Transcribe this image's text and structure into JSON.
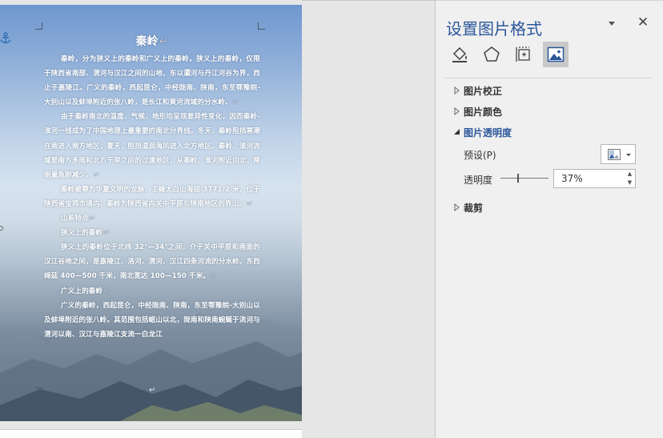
{
  "document": {
    "title": "秦岭",
    "paragraphs": [
      "秦岭，分为狭义上的秦岭和广义上的秦岭。狭义上的秦岭，仅限于陕西省南部、渭河与汉江之间的山地，东以灞河与丹江河谷为界，西止于嘉陵江。广义的秦岭，西起昆仑，中经陇南、陕南，东至鄂豫皖-大别山以及蚌埠附近的张八岭，是长江和黄河流域的分水岭。",
      "由于秦岭南北的温度、气候、地形均呈现差异性变化，因而秦岭-淮河一线成为了中国地理上最重要的南北分界线。冬天，秦岭阻挡寒潮在南进入南方地区；夏天，阻挡湿润海风进入北方地区。秦岭、淮河流域是南方多雨和北方干旱之间的过渡地区，从秦岭、淮河附近向北，降雨量急剧减少。",
      "秦岭被尊为华夏文明的龙脉，主峰太白山海拔 3771.2 米，位于陕西省宝鸡市境内。秦岭为陕西省内关中平原与陕南地区的界山。",
      "山系特点",
      "狭义上的秦岭",
      "狭义上的秦岭位于北纬 32°—34°之间，介于关中平原和南面的汉江谷地之间，是嘉陵江、洛河、渭河、汉江四条河流的分水岭。东西绵延 400—500 千米，南北宽达 100—150 千米。",
      "广义上的秦岭",
      "广义的秦岭，西起昆仑，中经陇南、陕南，东至鄂豫皖-大别山以及蚌埠附近的张八岭。其范围包括岷山以北，陇南和陕南蜿蜒于洮河与渭河以南、汉江与嘉陵江支流一白龙江"
    ]
  },
  "pane": {
    "title": "设置图片格式",
    "tabs": [
      {
        "icon": "fill-bucket-icon"
      },
      {
        "icon": "pentagon-effects-icon"
      },
      {
        "icon": "layout-size-icon"
      },
      {
        "icon": "picture-icon"
      }
    ],
    "sections": {
      "correction": "图片校正",
      "color": "图片颜色",
      "transparency": "图片透明度",
      "crop": "裁剪"
    },
    "preset_label": "预设(P)",
    "transparency_label": "透明度",
    "transparency_value": "37%",
    "transparency_fraction": 0.37
  }
}
